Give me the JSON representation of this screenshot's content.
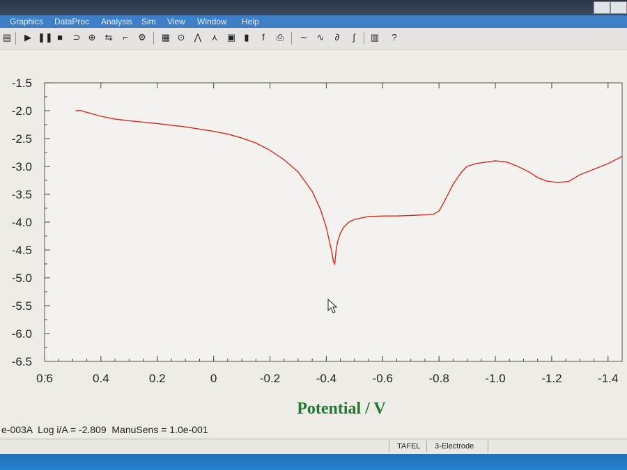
{
  "menu": [
    "Graphics",
    "DataProc",
    "Analysis",
    "Sim",
    "View",
    "Window",
    "Help"
  ],
  "status": {
    "line": "e-003A  Log i/A = -2.809  ManuSens = 1.0e-001",
    "technique": "TAFEL",
    "electrode": "3-Electrode"
  },
  "toolbar_icons": [
    "open-icon",
    "play-icon",
    "pause-icon",
    "stop-icon",
    "tool-icon",
    "tool-icon",
    "tool-icon",
    "tool-icon",
    "tool-icon",
    "tool-icon",
    "tool-icon",
    "tool-icon",
    "tool-icon",
    "tool-icon",
    "tool-icon",
    "tool-icon",
    "font-icon",
    "tool-icon",
    "tool-icon",
    "tool-icon",
    "tool-icon",
    "tool-icon",
    "tool-icon",
    "help-icon"
  ],
  "chart_data": {
    "type": "line",
    "xlabel": "Potential / V",
    "ylabel": "",
    "xlim": [
      0.6,
      -1.45
    ],
    "ylim": [
      -6.5,
      -1.5
    ],
    "x_ticks": [
      "0.6",
      "0.4",
      "0.2",
      "0",
      "-0.2",
      "-0.4",
      "-0.6",
      "-0.8",
      "-1.0",
      "-1.2",
      "-1.4"
    ],
    "x_tick_values": [
      0.6,
      0.4,
      0.2,
      0,
      -0.2,
      -0.4,
      -0.6,
      -0.8,
      -1.0,
      -1.2,
      -1.4
    ],
    "y_ticks": [
      "-1.5",
      "-2.0",
      "-2.5",
      "-3.0",
      "-3.5",
      "-4.0",
      "-4.5",
      "-5.0",
      "-5.5",
      "-6.0",
      "-6.5"
    ],
    "y_tick_values": [
      -1.5,
      -2.0,
      -2.5,
      -3.0,
      -3.5,
      -4.0,
      -4.5,
      -5.0,
      -5.5,
      -6.0,
      -6.5
    ],
    "grid": true,
    "line_color": "#d42a1e",
    "series": [
      {
        "x": [
          0.49,
          0.47,
          0.45,
          0.4,
          0.35,
          0.3,
          0.2,
          0.1,
          0.0,
          -0.05,
          -0.1,
          -0.15,
          -0.2,
          -0.25,
          -0.3,
          -0.35,
          -0.38,
          -0.4,
          -0.41,
          -0.42,
          -0.425,
          -0.43,
          -0.435,
          -0.44,
          -0.445,
          -0.45,
          -0.46,
          -0.48,
          -0.5,
          -0.55,
          -0.6,
          -0.65,
          -0.7,
          -0.75,
          -0.78,
          -0.8,
          -0.82,
          -0.85,
          -0.88,
          -0.9,
          -0.93,
          -0.97,
          -1.0,
          -1.04,
          -1.08,
          -1.12,
          -1.15,
          -1.18,
          -1.22,
          -1.26,
          -1.3,
          -1.35,
          -1.4,
          -1.45
        ],
        "y": [
          -2.0,
          -2.0,
          -2.03,
          -2.1,
          -2.15,
          -2.18,
          -2.23,
          -2.29,
          -2.37,
          -2.42,
          -2.49,
          -2.58,
          -2.71,
          -2.88,
          -3.1,
          -3.45,
          -3.78,
          -4.1,
          -4.32,
          -4.55,
          -4.7,
          -4.75,
          -4.5,
          -4.35,
          -4.27,
          -4.2,
          -4.1,
          -4.0,
          -3.95,
          -3.9,
          -3.89,
          -3.89,
          -3.88,
          -3.87,
          -3.86,
          -3.8,
          -3.62,
          -3.32,
          -3.1,
          -3.0,
          -2.95,
          -2.92,
          -2.9,
          -2.92,
          -3.0,
          -3.1,
          -3.2,
          -3.26,
          -3.29,
          -3.27,
          -3.15,
          -3.05,
          -2.95,
          -2.82
        ]
      }
    ]
  }
}
